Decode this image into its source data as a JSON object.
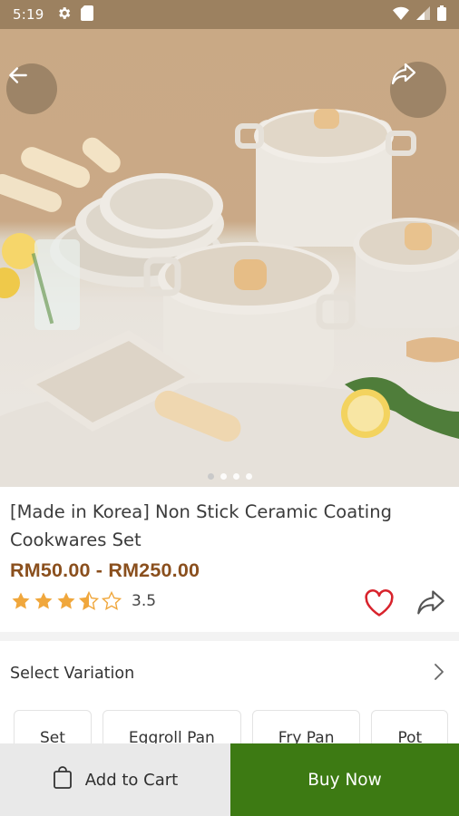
{
  "status_bar": {
    "time": "5:19",
    "icons": [
      "gear-icon",
      "sd-card-icon",
      "wifi-icon",
      "signal-icon",
      "battery-icon"
    ]
  },
  "hero": {
    "image_count": 4,
    "active_index": 0
  },
  "product": {
    "title": "[Made in Korea] Non Stick Ceramic Coating Cookwares Set",
    "price": "RM50.00 - RM250.00",
    "rating": 3.5,
    "rating_text": "3.5"
  },
  "variation": {
    "label": "Select Variation",
    "options": [
      "Set",
      "Eggroll Pan",
      "Fry Pan",
      "Pot"
    ]
  },
  "bottom_bar": {
    "add_to_cart": "Add to Cart",
    "buy_now": "Buy Now"
  },
  "colors": {
    "price": "#8a4f1d",
    "star": "#f0a73c",
    "heart": "#d8232c",
    "buy_now_bg": "#3d7a13",
    "status_bar_bg": "#9c8160"
  }
}
